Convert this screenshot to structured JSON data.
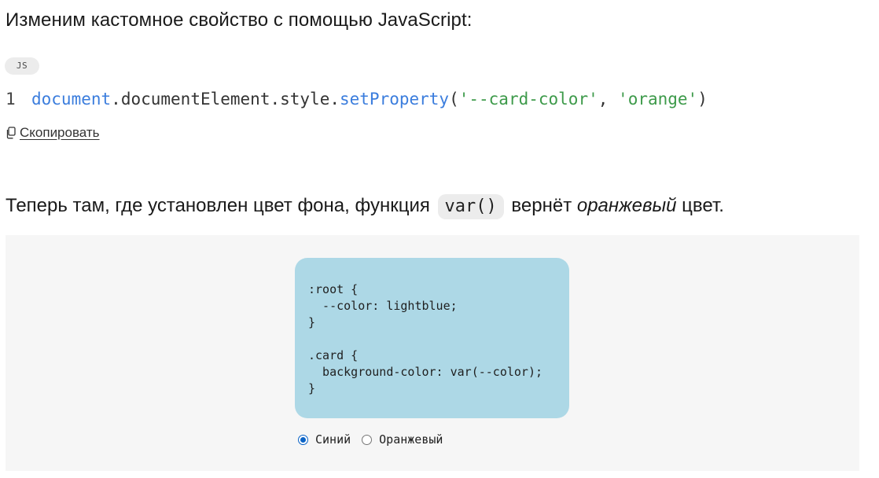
{
  "intro_text": "Изменим кастомное свойство с помощью JavaScript:",
  "code_block": {
    "language_badge": "JS",
    "line_number": "1",
    "tokens": {
      "obj": "document",
      "dot1": ".",
      "prop1": "documentElement",
      "dot2": ".",
      "prop2": "style",
      "dot3": ".",
      "method": "setProperty",
      "paren_open": "(",
      "arg1": "'--card-color'",
      "comma": ", ",
      "arg2": "'orange'",
      "paren_close": ")"
    },
    "copy_label": "Скопировать"
  },
  "paragraph": {
    "before": "Теперь там, где установлен цвет фона, функция ",
    "code": "var()",
    "middle": " вернёт ",
    "emphasis": "оранжевый",
    "after": " цвет."
  },
  "demo": {
    "card_css": ":root {\n  --color: lightblue;\n}\n\n.card {\n  background-color: var(--color);\n}",
    "card_color": "#add8e6",
    "radio_options": [
      {
        "label": "Синий",
        "checked": true
      },
      {
        "label": "Оранжевый",
        "checked": false
      }
    ]
  },
  "colors": {
    "token_object": "#3b7ddd",
    "token_string": "#3d9a4a",
    "radio_accent": "#0b63c6",
    "demo_background": "#f6f6f6"
  }
}
